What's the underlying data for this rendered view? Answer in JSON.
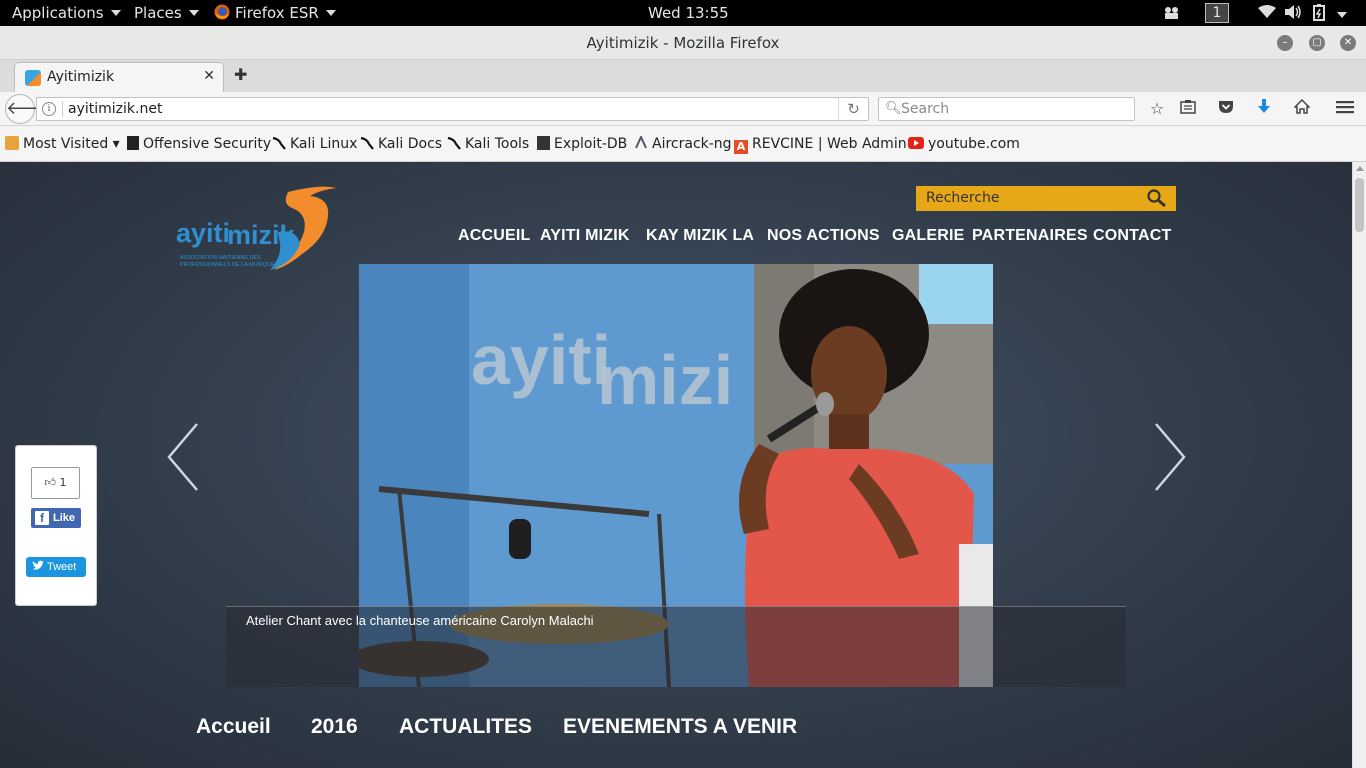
{
  "desktop": {
    "applications_label": "Applications",
    "places_label": "Places",
    "firefox_label": "Firefox ESR",
    "clock": "Wed 13:55",
    "workspace": "1"
  },
  "window": {
    "title": "Ayitimizik - Mozilla Firefox"
  },
  "tabs": [
    {
      "label": "Ayitimizik"
    }
  ],
  "address": {
    "url": "ayitimizik.net"
  },
  "search": {
    "placeholder": "Search"
  },
  "bookmarks": [
    {
      "label": "Most Visited ▾"
    },
    {
      "label": "Offensive Security"
    },
    {
      "label": "Kali Linux"
    },
    {
      "label": "Kali Docs"
    },
    {
      "label": "Kali Tools"
    },
    {
      "label": "Exploit-DB"
    },
    {
      "label": "Aircrack-ng"
    },
    {
      "label": "REVCINE | Web Admin"
    },
    {
      "label": "youtube.com"
    }
  ],
  "site": {
    "logo_text_1": "ayiti",
    "logo_text_2": "mizik",
    "logo_tagline_1": "ASSOCIATION HAITIENNE DES",
    "logo_tagline_2": "PROFESSIONNELS DE LA MUSIQUE",
    "search_placeholder": "Recherche",
    "nav": [
      "ACCUEIL",
      "AYITI MIZIK",
      "KAY MIZIK LA",
      "NOS ACTIONS",
      "GALERIE",
      "PARTENAIRES",
      "CONTACT"
    ],
    "slide_banner_text_1": "ayiti",
    "slide_banner_text_2": "mizi",
    "slide_caption": "Atelier Chant avec la chanteuse américaine Carolyn Malachi",
    "like_count": "1",
    "like_label": "Like",
    "tweet_label": "Tweet",
    "subnav": [
      "Accueil",
      "2016",
      "ACTUALITES",
      "EVENEMENTS A VENIR"
    ]
  },
  "colors": {
    "accent_orange": "#e6a817",
    "facebook_blue": "#4267b2",
    "twitter_blue": "#1b95e0",
    "logo_blue": "#2f8fd0",
    "logo_orange": "#f28c2c"
  }
}
